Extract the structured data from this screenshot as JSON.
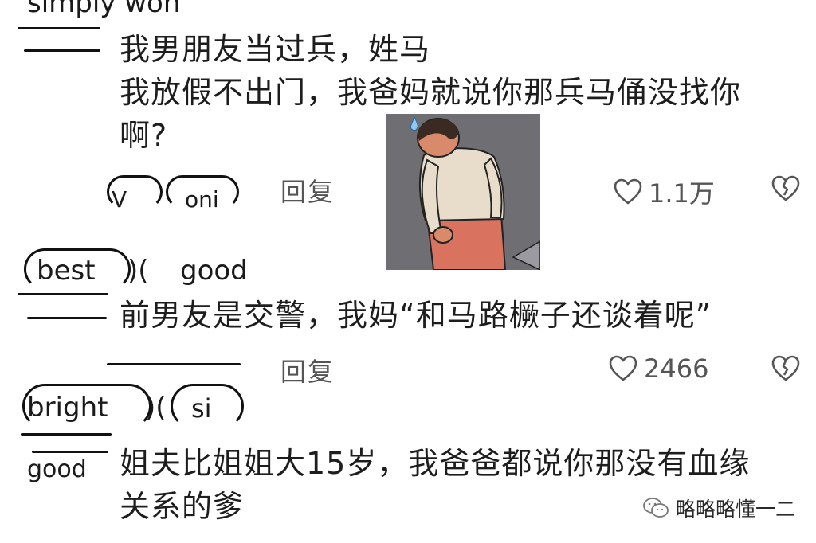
{
  "comments": [
    {
      "username_fragment": "simply won",
      "lines": [
        "我男朋友当过兵，姓马",
        "我放假不出门，我爸妈就说你那兵马俑没找你",
        "啊?"
      ],
      "reply_label": "回复",
      "likes": "1.1万",
      "badge_fragments": [
        "V",
        "oni"
      ]
    },
    {
      "username_fragments": [
        "best",
        ")(",
        "good"
      ],
      "lines": [
        "前男友是交警，我妈“和马路橛子还谈着呢”"
      ],
      "reply_label": "回复",
      "likes": "2466"
    },
    {
      "username_fragments": [
        "bright",
        ")(",
        "si",
        "good"
      ],
      "lines": [
        "姐夫比姐姐大15岁，我爸爸都说你那没有血缘",
        "关系的爹"
      ]
    }
  ],
  "sticker": {
    "description_icon": "sweat-drop-sticker"
  },
  "watermark": {
    "text": "略略略懂一二",
    "icon": "wechat-icon"
  },
  "colors": {
    "text": "#1d1d1d",
    "muted": "#555555",
    "sticker_bg": "#6f6f73",
    "shirt": "#e8dccb",
    "pants": "#d9735f",
    "hair": "#3a2a22",
    "skin": "#d98a6a",
    "sweat": "#8ec9f2"
  }
}
